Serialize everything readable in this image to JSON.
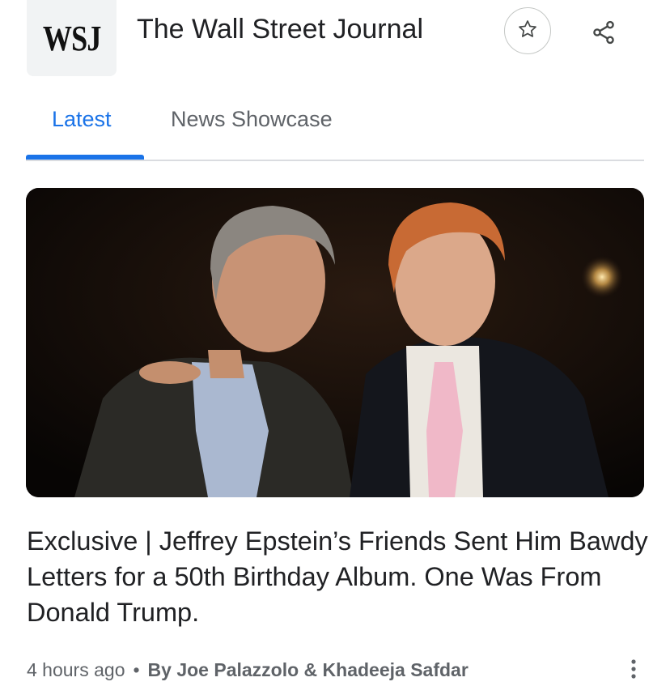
{
  "publisher": {
    "logo_text": "WSJ",
    "name": "The Wall Street Journal",
    "follow_icon": "star-icon",
    "share_icon": "share-icon"
  },
  "tabs": [
    {
      "label": "Latest",
      "active": true
    },
    {
      "label": "News Showcase",
      "active": false
    }
  ],
  "article": {
    "image_icon": "photo-two-men-in-suits",
    "headline": "Exclusive | Jeffrey Epstein’s Friends Sent Him Bawdy Letters for a 50th Birthday Album. One Was From Donald Trump.",
    "time": "4 hours ago",
    "separator": "•",
    "byline": "By Joe Palazzolo & Khadeeja Safdar",
    "more_icon": "more-vert-icon"
  },
  "colors": {
    "accent": "#1a73e8",
    "text_primary": "#202124",
    "text_secondary": "#5f6368",
    "divider": "#dadce0"
  }
}
